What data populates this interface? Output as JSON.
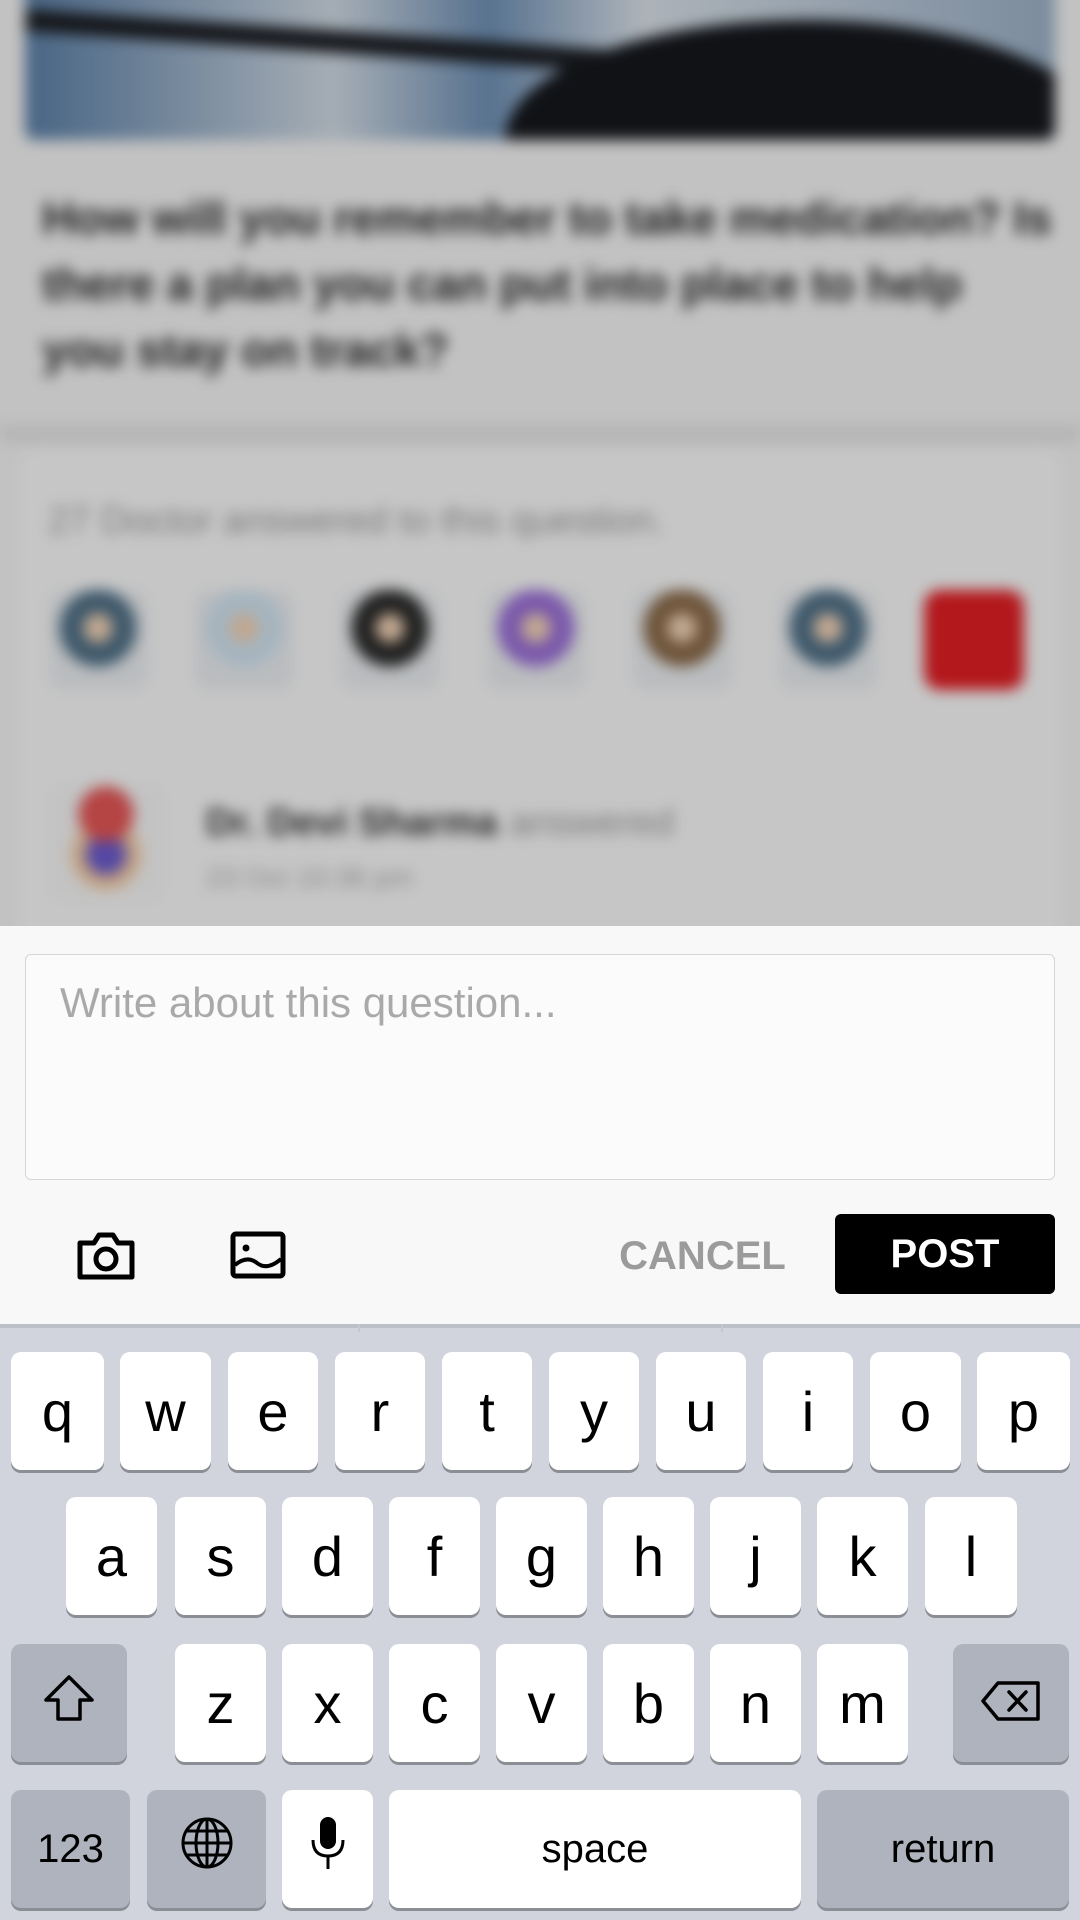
{
  "background": {
    "question": "How will you remember to take medication? Is there a plan you can put into place to help you stay on track?",
    "answered_count_text": "27 Doctor answered to this question.",
    "doctor_avatar_colors": [
      "#4f6f86",
      "#cfe2ef",
      "#2a2a2a",
      "#9a6fd6",
      "#8a6a4a",
      "#4f6f86",
      "#e01e24"
    ],
    "answer": {
      "doctor_name": "Dr. Devi Sharma",
      "action": "answered",
      "date": "23 Oct 10:36 pm"
    }
  },
  "composer": {
    "placeholder": "Write about this question...",
    "camera_icon": "camera-icon",
    "gallery_icon": "image-gallery-icon",
    "cancel_label": "CANCEL",
    "post_label": "POST"
  },
  "keyboard": {
    "row1": [
      "q",
      "w",
      "e",
      "r",
      "t",
      "y",
      "u",
      "i",
      "o",
      "p"
    ],
    "row2": [
      "a",
      "s",
      "d",
      "f",
      "g",
      "h",
      "j",
      "k",
      "l"
    ],
    "row3": [
      "z",
      "x",
      "c",
      "v",
      "b",
      "n",
      "m"
    ],
    "numbers_label": "123",
    "space_label": "space",
    "return_label": "return",
    "shift_icon": "shift-icon",
    "backspace_icon": "backspace-icon",
    "globe_icon": "globe-icon",
    "mic_icon": "microphone-icon"
  }
}
